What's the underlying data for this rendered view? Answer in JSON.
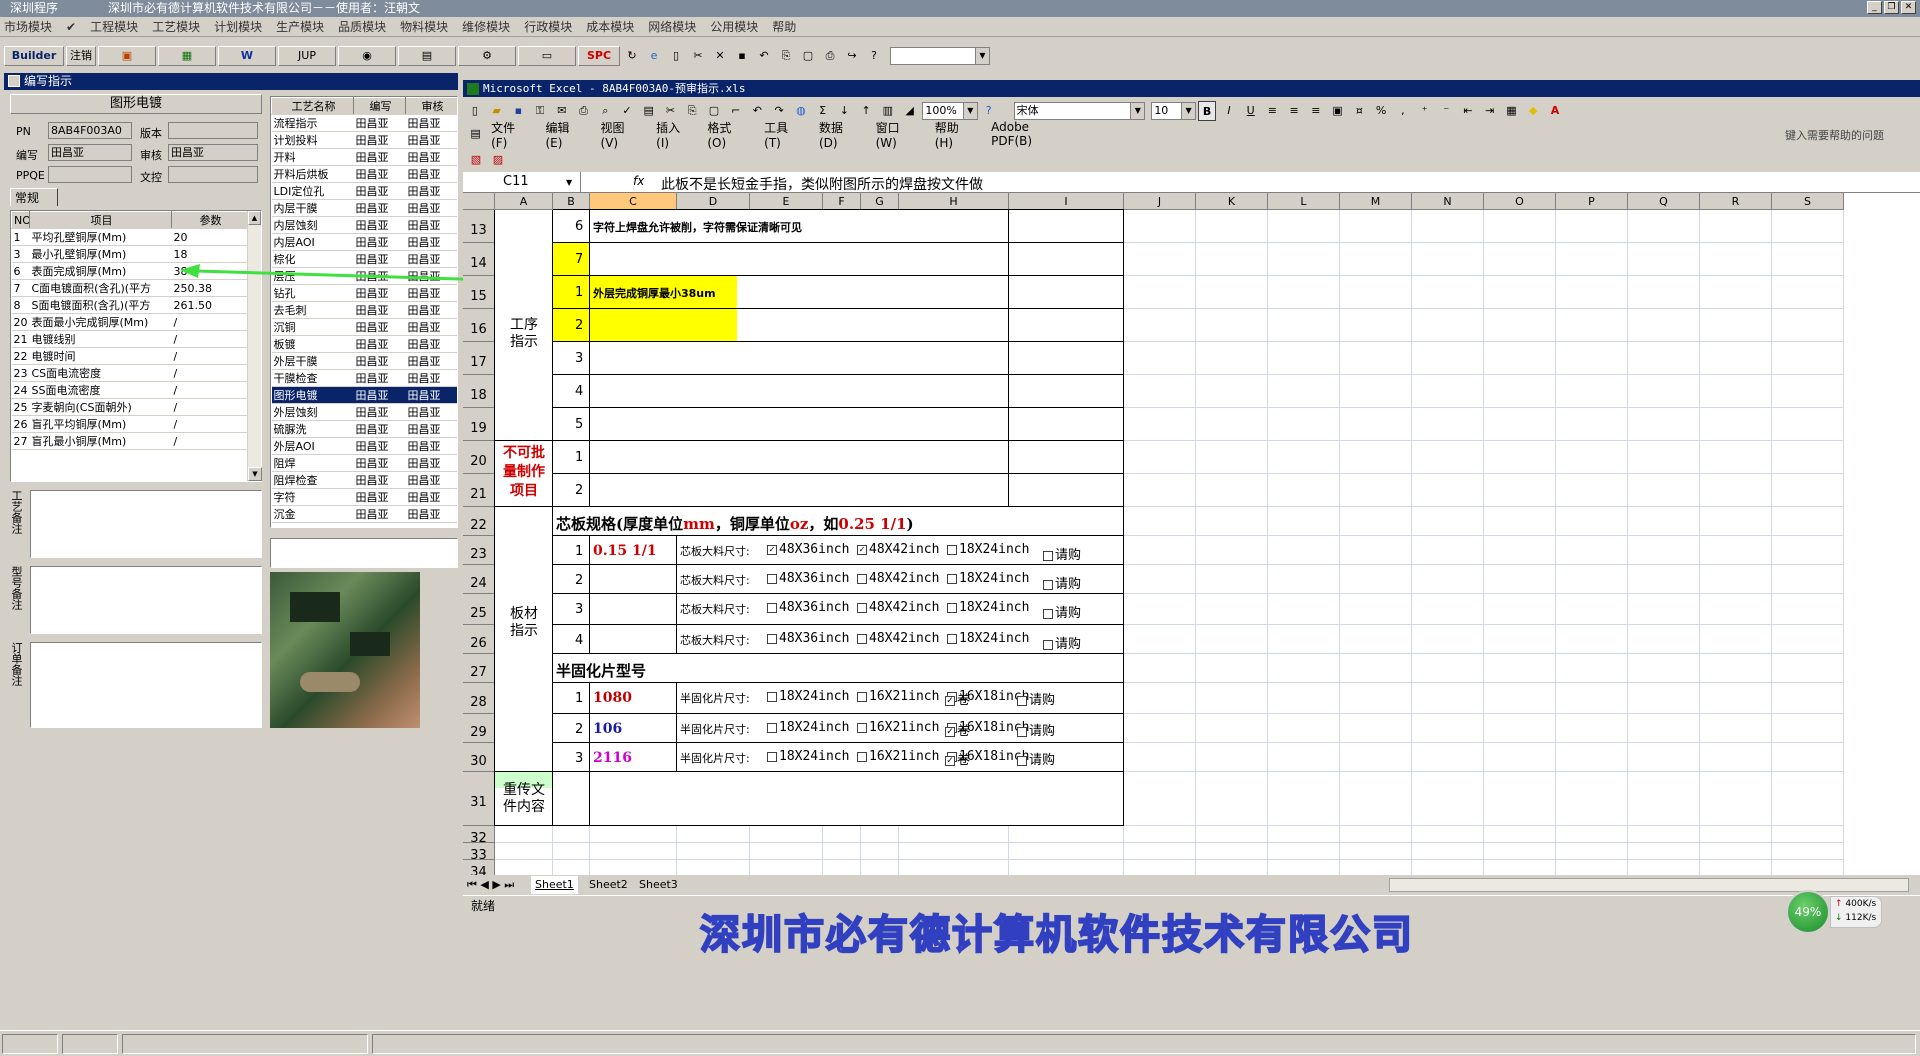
{
  "app": {
    "title": "深圳程序",
    "subtitle": "深圳市必有德计算机软件技术有限公司－－使用者：汪朝文"
  },
  "menu": [
    "市场模块",
    "工程模块",
    "工艺模块",
    "计划模块",
    "生产模块",
    "品质模块",
    "物料模块",
    "维修模块",
    "行政模块",
    "成本模块",
    "网络模块",
    "公用模块",
    "帮助"
  ],
  "toolbar": {
    "builder": "Builder",
    "logout": "注销",
    "jup": "JUP",
    "spc": "SPC"
  },
  "left_panel": {
    "title": "编写指示",
    "section_title": "图形电镀",
    "fields": {
      "pn_label": "PN",
      "pn_value": "8AB4F003A0",
      "version_label": "版本",
      "version_value": "",
      "author_label": "编写",
      "author_value": "田昌亚",
      "review_label": "审核",
      "review_value": "田昌亚",
      "pfqe_label": "PPQE",
      "pfqe_value": "",
      "doc_label": "文控",
      "doc_value": ""
    },
    "tab": "常规",
    "params_headers": [
      "NO",
      "项目",
      "参数"
    ],
    "params": [
      {
        "no": "1",
        "item": "平均孔壁铜厚(Μm)",
        "value": "20"
      },
      {
        "no": "3",
        "item": "最小孔壁铜厚(Μm)",
        "value": "18"
      },
      {
        "no": "6",
        "item": "表面完成铜厚(Μm)",
        "value": "38"
      },
      {
        "no": "7",
        "item": "C面电镀面积(含孔)(平方",
        "value": "250.38"
      },
      {
        "no": "8",
        "item": "S面电镀面积(含孔)(平方",
        "value": "261.50"
      },
      {
        "no": "20",
        "item": "表面最小完成铜厚(Μm)",
        "value": "/"
      },
      {
        "no": "21",
        "item": "电镀线别",
        "value": "/"
      },
      {
        "no": "22",
        "item": "电镀时间",
        "value": "/"
      },
      {
        "no": "23",
        "item": "CS面电流密度",
        "value": "/"
      },
      {
        "no": "24",
        "item": "SS面电流密度",
        "value": "/"
      },
      {
        "no": "25",
        "item": "字麦朝向(CS面朝外)",
        "value": "/"
      },
      {
        "no": "26",
        "item": "盲孔平均铜厚(Μm)",
        "value": "/"
      },
      {
        "no": "27",
        "item": "盲孔最小铜厚(Μm)",
        "value": "/"
      }
    ],
    "remark_labels": [
      "工艺备注",
      "型号备注",
      "订单备注"
    ],
    "process_headers": [
      "工艺名称",
      "编写",
      "审核"
    ],
    "processes": [
      "流程指示",
      "计划投料",
      "开料",
      "开料后烘板",
      "LDI定位孔",
      "内层干膜",
      "内层蚀刻",
      "内层AOI",
      "棕化",
      "层压",
      "钻孔",
      "去毛刺",
      "沉铜",
      "板镀",
      "外层干膜",
      "干膜检查",
      "图形电镀",
      "外层蚀刻",
      "硫脲洗",
      "外层AOI",
      "阻焊",
      "阻焊检查",
      "字符",
      "沉金"
    ],
    "process_person": "田昌亚",
    "selected_process": "图形电镀"
  },
  "excel": {
    "title": "Microsoft Excel - 8AB4F003A0-预审指示.xls",
    "menus": [
      "文件(F)",
      "编辑(E)",
      "视图(V)",
      "插入(I)",
      "格式(O)",
      "工具(T)",
      "数据(D)",
      "窗口(W)",
      "帮助(H)",
      "Adobe PDF(B)"
    ],
    "help_placeholder": "键入需要帮助的问题",
    "zoom": "100%",
    "font_name": "宋体",
    "font_size": "10",
    "name_box": "C11",
    "fx": "fx",
    "formula": "此板不是长短金手指，类似附图所示的焊盘按文件做",
    "columns": [
      "A",
      "B",
      "C",
      "D",
      "E",
      "F",
      "G",
      "H",
      "I",
      "J",
      "K",
      "L",
      "M",
      "N",
      "O",
      "P",
      "Q",
      "R",
      "S"
    ],
    "rows": [
      "13",
      "14",
      "15",
      "16",
      "17",
      "18",
      "19",
      "20",
      "21",
      "22",
      "23",
      "24",
      "25",
      "26",
      "27",
      "28",
      "29",
      "30",
      "31",
      "32",
      "33",
      "34"
    ],
    "row13_text": "字符上焊盘允许被削，字符需保证清晰可见",
    "row15_text": "外层完成铜厚最小38um",
    "process_label": "工序\n指示",
    "nobatch_label": "不可批\n量制作\n项目",
    "board_label": "板材\n指示",
    "reupload_label": "重传文\n件内容",
    "b_values": [
      "6",
      "7",
      "1",
      "2",
      "3",
      "4",
      "5",
      "1",
      "2"
    ],
    "core_title_a": "芯板规格(厚度单位",
    "core_title_mm": "mm",
    "core_title_b": "，铜厚单位",
    "core_title_oz": "oz",
    "core_title_c": "，如",
    "core_title_ex": "0.25 1/1",
    "core_title_d": ")",
    "core_rows": [
      {
        "n": "1",
        "spec": "0.15 1/1",
        "checked": [
          true,
          true,
          false
        ]
      },
      {
        "n": "2",
        "spec": "",
        "checked": [
          false,
          false,
          false
        ]
      },
      {
        "n": "3",
        "spec": "",
        "checked": [
          false,
          false,
          false
        ]
      },
      {
        "n": "4",
        "spec": "",
        "checked": [
          false,
          false,
          false
        ]
      }
    ],
    "core_size_label": "芯板大料尺寸:",
    "core_sizes": [
      "48X36inch",
      "48X42inch",
      "18X24inch"
    ],
    "purchase": "请购",
    "prepreg_title": "半固化片型号",
    "prepreg_rows": [
      {
        "n": "1",
        "model": "1080",
        "color": "#c00000"
      },
      {
        "n": "2",
        "model": "106",
        "color": "#1a1a9a"
      },
      {
        "n": "3",
        "model": "2116",
        "color": "#d000d0"
      }
    ],
    "prepreg_size_label": "半固化片尺寸:",
    "prepreg_sizes": [
      "18X24inch",
      "16X21inch",
      "16X18inch"
    ],
    "roll": "卷",
    "sheet_tabs": [
      "Sheet1",
      "Sheet2",
      "Sheet3"
    ],
    "status": "就绪"
  },
  "company_banner": "深圳市必有德计算机软件技术有限公司",
  "net_widget": {
    "percent": "49%",
    "up": "400K/s",
    "down": "112K/s"
  }
}
